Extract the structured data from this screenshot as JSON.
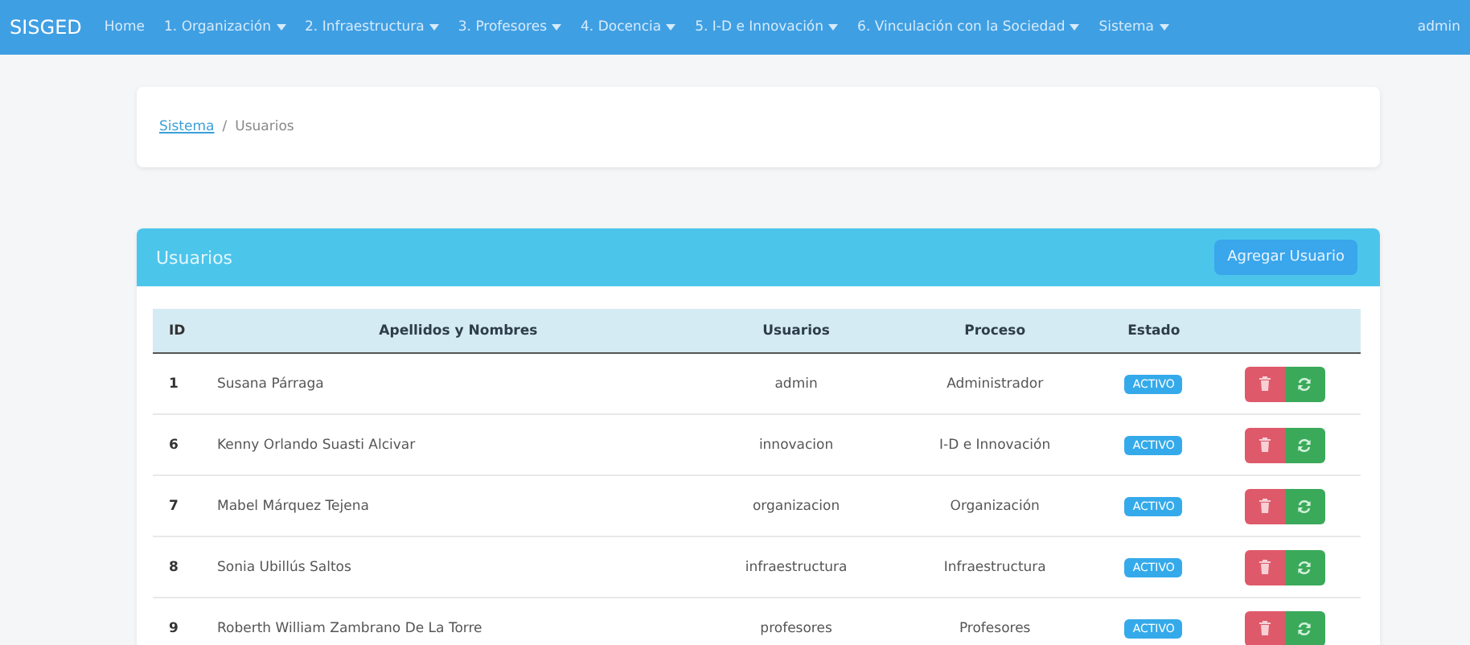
{
  "navbar": {
    "brand": "SISGED",
    "items": [
      {
        "label": "Home",
        "dropdown": false
      },
      {
        "label": "1. Organización",
        "dropdown": true
      },
      {
        "label": "2. Infraestructura",
        "dropdown": true
      },
      {
        "label": "3. Profesores",
        "dropdown": true
      },
      {
        "label": "4. Docencia",
        "dropdown": true
      },
      {
        "label": "5. I-D e Innovación",
        "dropdown": true
      },
      {
        "label": "6. Vinculación con la Sociedad",
        "dropdown": true
      },
      {
        "label": "Sistema",
        "dropdown": true
      }
    ],
    "user": "admin"
  },
  "breadcrumb": {
    "link": "Sistema",
    "separator": "/",
    "current": "Usuarios"
  },
  "panel": {
    "title": "Usuarios",
    "add_button": "Agregar Usuario"
  },
  "table": {
    "columns": [
      "ID",
      "Apellidos y Nombres",
      "Usuarios",
      "Proceso",
      "Estado"
    ],
    "rows": [
      {
        "id": "1",
        "name": "Susana Párraga",
        "user": "admin",
        "process": "Administrador",
        "status": "ACTIVO"
      },
      {
        "id": "6",
        "name": "Kenny Orlando Suasti Alcivar",
        "user": "innovacion",
        "process": "I-D e Innovación",
        "status": "ACTIVO"
      },
      {
        "id": "7",
        "name": "Mabel Márquez Tejena",
        "user": "organizacion",
        "process": "Organización",
        "status": "ACTIVO"
      },
      {
        "id": "8",
        "name": "Sonia Ubillús Saltos",
        "user": "infraestructura",
        "process": "Infraestructura",
        "status": "ACTIVO"
      },
      {
        "id": "9",
        "name": "Roberth William Zambrano De La Torre",
        "user": "profesores",
        "process": "Profesores",
        "status": "ACTIVO"
      }
    ]
  }
}
